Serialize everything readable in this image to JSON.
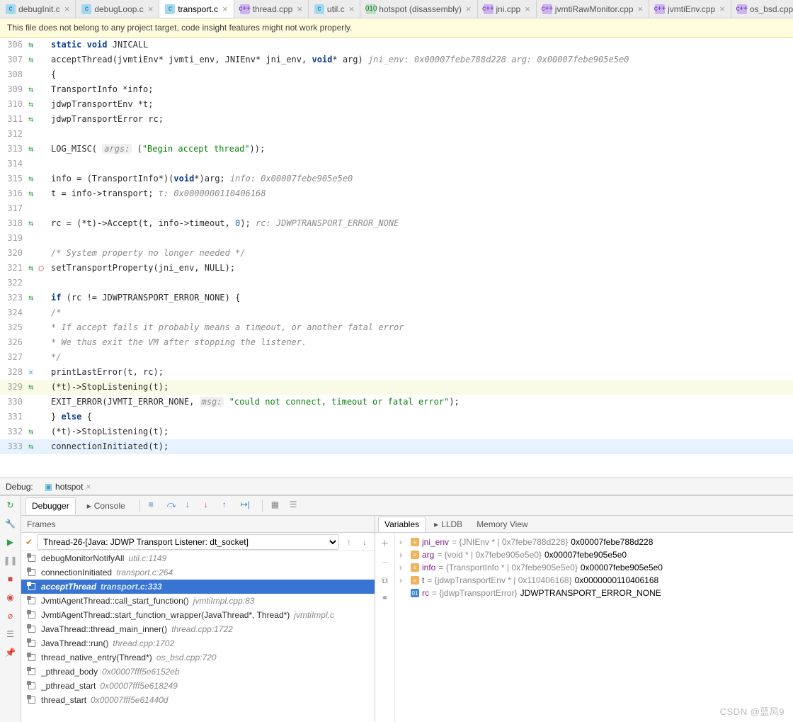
{
  "tabs": [
    {
      "label": "debugInit.c",
      "kind": "c",
      "active": false
    },
    {
      "label": "debugLoop.c",
      "kind": "c",
      "active": false
    },
    {
      "label": "transport.c",
      "kind": "c",
      "active": true
    },
    {
      "label": "thread.cpp",
      "kind": "cpp",
      "active": false
    },
    {
      "label": "util.c",
      "kind": "c",
      "active": false
    },
    {
      "label": "hotspot (disassembly)",
      "kind": "bin",
      "active": false
    },
    {
      "label": "jni.cpp",
      "kind": "cpp",
      "active": false
    },
    {
      "label": "jvmtiRawMonitor.cpp",
      "kind": "cpp",
      "active": false
    },
    {
      "label": "jvmtiEnv.cpp",
      "kind": "cpp",
      "active": false
    },
    {
      "label": "os_bsd.cpp",
      "kind": "cpp",
      "active": false
    }
  ],
  "banner": {
    "text": "This file does not belong to any project target, code insight features might not work properly."
  },
  "code": {
    "lines": [
      {
        "n": 306,
        "mk": "↔",
        "html": "<span class='c-kw'>static</span> <span class='c-kw'>void</span> JNICALL"
      },
      {
        "n": 307,
        "mk": "↔",
        "html": "acceptThread(jvmtiEnv* jvmti_env, JNIEnv* jni_env, <span class='c-kw'>void</span>* arg)   <span class='c-hint'>jni_env: 0x00007febe788d228     arg: 0x00007febe905e5e0</span>"
      },
      {
        "n": 308,
        "mk": "",
        "html": "{"
      },
      {
        "n": 309,
        "mk": "↔",
        "html": "    TransportInfo *info;"
      },
      {
        "n": 310,
        "mk": "↔",
        "html": "    jdwpTransportEnv *t;"
      },
      {
        "n": 311,
        "mk": "↔",
        "html": "    jdwpTransportError rc;"
      },
      {
        "n": 312,
        "mk": "",
        "html": ""
      },
      {
        "n": 313,
        "mk": "↔",
        "html": "    LOG_MISC( <span class='c-hintbox'>args:</span> (<span class='c-str'>\"Begin accept thread\"</span>));"
      },
      {
        "n": 314,
        "mk": "",
        "html": ""
      },
      {
        "n": 315,
        "mk": "↔",
        "html": "    info = (TransportInfo*)(<span class='c-kw'>void</span>*)arg;   <span class='c-hint'>info: 0x00007febe905e5e0</span>"
      },
      {
        "n": 316,
        "mk": "↔",
        "html": "    t = info-&gt;transport;   <span class='c-hint'>t: 0x0000000110406168</span>"
      },
      {
        "n": 317,
        "mk": "",
        "html": ""
      },
      {
        "n": 318,
        "mk": "↔",
        "html": "    rc = (*t)-&gt;Accept(t, info-&gt;timeout, <span class='c-num'>0</span>);   <span class='c-hint'>rc: JDWPTRANSPORT_ERROR_NONE</span>"
      },
      {
        "n": 319,
        "mk": "",
        "html": ""
      },
      {
        "n": 320,
        "mk": "",
        "html": "    <span class='c-cmt'>/* System property no longer needed */</span>"
      },
      {
        "n": 321,
        "mk": "↔●",
        "html": "    setTransportProperty(jni_env, NULL);"
      },
      {
        "n": 322,
        "mk": "",
        "html": ""
      },
      {
        "n": 323,
        "mk": "↔",
        "html": "    <span class='c-kw'>if</span> (rc != JDWPTRANSPORT_ERROR_NONE) {"
      },
      {
        "n": 324,
        "mk": "",
        "html": "        <span class='c-cmt'>/*</span>"
      },
      {
        "n": 325,
        "mk": "",
        "html": "        <span class='c-cmt'> * If accept fails it probably means a timeout, or another fatal error</span>"
      },
      {
        "n": 326,
        "mk": "",
        "html": "        <span class='c-cmt'> * We thus exit the VM after stopping the listener.</span>"
      },
      {
        "n": 327,
        "mk": "",
        "html": "        <span class='c-cmt'> */</span>"
      },
      {
        "n": 328,
        "mk": "✕",
        "html": "        printLastError(t, rc);"
      },
      {
        "n": 329,
        "mk": "↔",
        "html": "        (*t)-&gt;StopListening(t);",
        "mod": true
      },
      {
        "n": 330,
        "mk": "",
        "html": "        EXIT_ERROR(JVMTI_ERROR_NONE,  <span class='c-hintbox'>msg:</span> <span class='c-str'>\"could not connect, timeout or fatal error\"</span>);"
      },
      {
        "n": 331,
        "mk": "",
        "html": "    } <span class='c-kw'>else</span> {"
      },
      {
        "n": 332,
        "mk": "↔",
        "html": "        (*t)-&gt;StopListening(t);"
      },
      {
        "n": 333,
        "mk": "↔",
        "html": "        connectionInitiated(t);",
        "hl": true
      }
    ]
  },
  "debug": {
    "title": "Debug:",
    "session": "hotspot",
    "tabs": {
      "debugger": "Debugger",
      "console": "Console"
    },
    "frames": {
      "title": "Frames",
      "thread": "Thread-26-[Java: JDWP Transport Listener: dt_socket]",
      "stack": [
        {
          "fn": "debugMonitorNotifyAll",
          "loc": "util.c:1149",
          "sel": false
        },
        {
          "fn": "connectionInitiated",
          "loc": "transport.c:264",
          "sel": false
        },
        {
          "fn": "acceptThread",
          "loc": "transport.c:333",
          "sel": true
        },
        {
          "fn": "JvmtiAgentThread::call_start_function()",
          "loc": "jvmtiImpl.cpp:83",
          "sel": false
        },
        {
          "fn": "JvmtiAgentThread::start_function_wrapper(JavaThread*, Thread*)",
          "loc": "jvmtiImpl.c",
          "sel": false
        },
        {
          "fn": "JavaThread::thread_main_inner()",
          "loc": "thread.cpp:1722",
          "sel": false
        },
        {
          "fn": "JavaThread::run()",
          "loc": "thread.cpp:1702",
          "sel": false
        },
        {
          "fn": "thread_native_entry(Thread*)",
          "loc": "os_bsd.cpp:720",
          "sel": false
        },
        {
          "fn": "_pthread_body",
          "loc": "0x00007fff5e6152eb",
          "sel": false
        },
        {
          "fn": "_pthread_start",
          "loc": "0x00007fff5e618249",
          "sel": false
        },
        {
          "fn": "thread_start",
          "loc": "0x00007fff5e61440d",
          "sel": false
        }
      ]
    },
    "vars": {
      "tabs": {
        "variables": "Variables",
        "lldb": "LLDB",
        "memory": "Memory View"
      },
      "rows": [
        {
          "name": "jni_env",
          "val": "= {JNIEnv * | 0x7febe788d228}",
          "addr": "0x00007febe788d228",
          "exp": true
        },
        {
          "name": "arg",
          "val": "= {void * | 0x7febe905e5e0}",
          "addr": "0x00007febe905e5e0",
          "exp": true
        },
        {
          "name": "info",
          "val": "= {TransportInfo * | 0x7febe905e5e0}",
          "addr": "0x00007febe905e5e0",
          "exp": true
        },
        {
          "name": "t",
          "val": "= {jdwpTransportEnv * | 0x110406168}",
          "addr": "0x0000000110406168",
          "exp": true
        },
        {
          "name": "rc",
          "val": "= {jdwpTransportError}",
          "addr": "JDWPTRANSPORT_ERROR_NONE",
          "exp": false,
          "rc": true
        }
      ]
    }
  },
  "watermark": "CSDN @蓝风9"
}
